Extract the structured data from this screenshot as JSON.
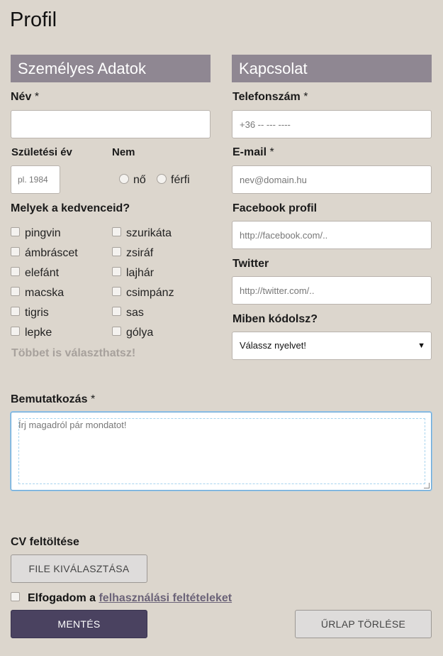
{
  "page": {
    "title": "Profil"
  },
  "personal": {
    "heading": "Személyes Adatok",
    "name_label": "Név",
    "required_mark": "*",
    "birth_year_label": "Születési év",
    "birth_year_placeholder": "pl. 1984",
    "gender_label": "Nem",
    "gender_options": [
      "nő",
      "férfi"
    ],
    "favorites_label": "Melyek a kedvenceid?",
    "favorites_col1": [
      "pingvin",
      "ámbráscet",
      "elefánt",
      "macska",
      "tigris",
      "lepke"
    ],
    "favorites_col2": [
      "szurikáta",
      "zsiráf",
      "lajhár",
      "csimpánz",
      "sas",
      "gólya"
    ],
    "favorites_hint": "Többet is választhatsz!"
  },
  "contact": {
    "heading": "Kapcsolat",
    "phone_label": "Telefonszám",
    "phone_placeholder": "+36 -- --- ----",
    "email_label": "E-mail",
    "email_placeholder": "nev@domain.hu",
    "facebook_label": "Facebook profil",
    "facebook_placeholder": "http://facebook.com/..",
    "twitter_label": "Twitter",
    "twitter_placeholder": "http://twitter.com/..",
    "language_label": "Miben kódolsz?",
    "language_selected": "Válassz nyelvet!"
  },
  "intro": {
    "label": "Bemutatkozás",
    "placeholder": "Írj magadról pár mondatot!"
  },
  "cv": {
    "label": "CV feltöltése",
    "button": "FILE KIVÁLASZTÁSA"
  },
  "terms": {
    "prefix": "Elfogadom a",
    "link": "felhasználási feltételeket"
  },
  "actions": {
    "save": "MENTÉS",
    "reset": "ŰRLAP TÖRLÉSE"
  },
  "colors": {
    "background": "#dcd6cd",
    "section_header": "#8f8792",
    "primary_button": "#4a4260"
  }
}
